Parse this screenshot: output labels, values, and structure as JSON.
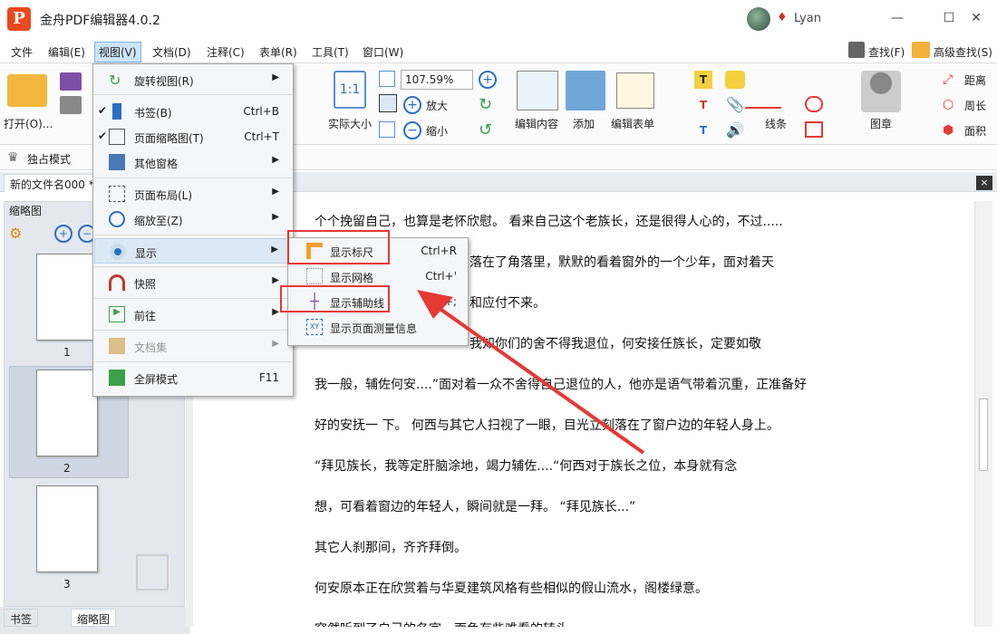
{
  "app": {
    "title": "金舟PDF编辑器4.0.2",
    "user": "Lyan",
    "logo_letter": "P"
  },
  "window": {
    "minimize": "—",
    "maximize": "☐",
    "close": "✕"
  },
  "menubar": {
    "items": [
      "文件",
      "编辑(E)",
      "视图(V)",
      "文档(D)",
      "注释(C)",
      "表单(R)",
      "工具(T)",
      "窗口(W)"
    ],
    "find": "查找(F)",
    "advanced_find": "高级查找(S)"
  },
  "toolbar": {
    "open": "打开(O)...",
    "actual_size": "实际大小",
    "zoom_value": "107.59%",
    "zoom_in": "放大",
    "zoom_out": "缩小",
    "edit_content": "编辑内容",
    "add": "添加",
    "edit_form": "编辑表单",
    "line": "线条",
    "stamp": "图章",
    "distance": "距离",
    "perimeter": "周长",
    "area": "面积",
    "exclusive_mode": "独占模式"
  },
  "doc_tab": {
    "name": "新的文件名000 *",
    "close": "×"
  },
  "left_panel": {
    "title": "缩略图",
    "pages": [
      "1",
      "2",
      "3"
    ],
    "tab_bookmarks": "书签",
    "tab_thumbs": "缩略图"
  },
  "view_menu": [
    {
      "label": "旋转视图(R)",
      "shortcut": "",
      "has_sub": true
    },
    {
      "label": "书签(B)",
      "shortcut": "Ctrl+B",
      "checked": true
    },
    {
      "label": "页面缩略图(T)",
      "shortcut": "Ctrl+T",
      "checked": true
    },
    {
      "label": "其他窗格",
      "shortcut": "",
      "has_sub": true
    },
    {
      "label": "页面布局(L)",
      "shortcut": "",
      "has_sub": true
    },
    {
      "label": "缩放至(Z)",
      "shortcut": "",
      "has_sub": true
    },
    {
      "label": "显示",
      "shortcut": "",
      "has_sub": true
    },
    {
      "label": "快照",
      "shortcut": "",
      "has_sub": true
    },
    {
      "label": "前往",
      "shortcut": "",
      "has_sub": true
    },
    {
      "label": "文档集",
      "shortcut": "",
      "has_sub": true
    },
    {
      "label": "全屏模式",
      "shortcut": "F11"
    }
  ],
  "display_submenu": [
    {
      "label": "显示标尺",
      "shortcut": "Ctrl+R"
    },
    {
      "label": "显示网格",
      "shortcut": "Ctrl+'"
    },
    {
      "label": "显示辅助线",
      "shortcut": "Ctrl+;"
    },
    {
      "label": "显示页面测量信息",
      "shortcut": ""
    }
  ],
  "document_text": [
    "个个挽留自己，也算是老怀欣慰。         看来自己这个老族长，还是很得人心的，不过.....",
    "落在了角落里，默默的看着窗外的一个少年，面对着天",
    "和应付不来。",
    "我知你们的舍不得我退位，何安接任族长，定要如敬",
    "我一般，辅佐何安....”面对着一众不舍得自己退位的人，他亦是语气带着沉重，正准备好",
    "好的安抚一   下。        何西与其它人扫视了一眼，目光立刻落在了窗户边的年轻人身上。",
    "“拜见族长，我等定肝脑涂地，竭力辅佐....“何西对于族长之位，本身就有念",
    "想，可看着窗边的年轻人，瞬间就是一拜。                          “拜见族长...”",
    "其它人刹那间，齐齐拜倒。",
    "何安原本正在欣赏着与华夏建筑风格有些相似的假山流水，阁楼绿意。",
    "突然听到了自己的名字，面色有些难看的转头"
  ],
  "colors": {
    "accent": "#e53935",
    "menu_highlight": "#dde8f5",
    "logo": "#e8491d"
  }
}
